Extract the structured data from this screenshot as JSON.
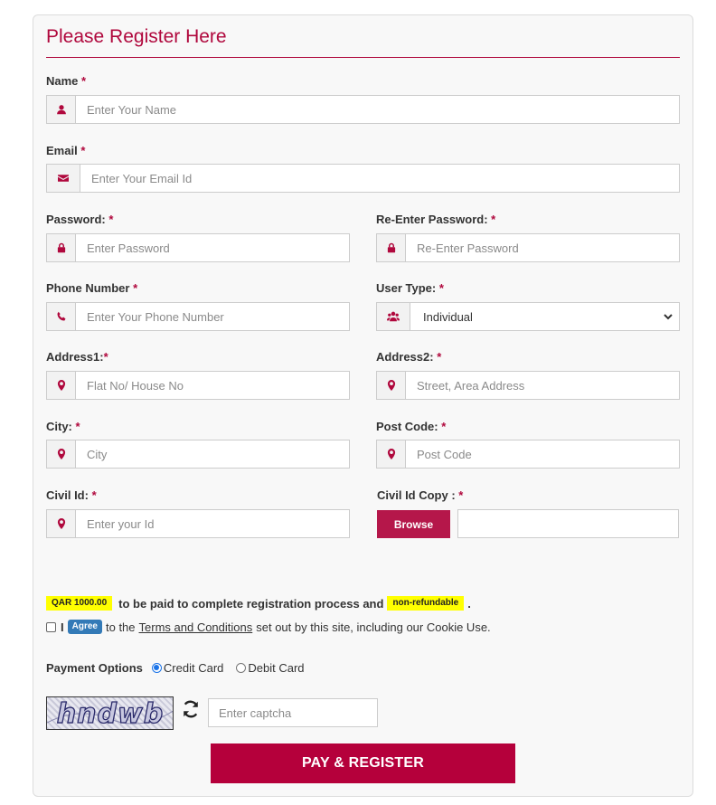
{
  "form": {
    "title": "Please Register Here"
  },
  "fields": {
    "name": {
      "label": "Name",
      "required": "*",
      "placeholder": "Enter Your Name",
      "icon": "user-icon"
    },
    "email": {
      "label": "Email",
      "required": "*",
      "placeholder": "Enter Your Email Id",
      "icon": "envelope-icon"
    },
    "password": {
      "label": "Password:",
      "required": "*",
      "placeholder": "Enter Password",
      "icon": "lock-icon"
    },
    "repassword": {
      "label": "Re-Enter Password:",
      "required": "*",
      "placeholder": "Re-Enter Password",
      "icon": "lock-icon"
    },
    "phone": {
      "label": "Phone Number",
      "required": "*",
      "placeholder": "Enter Your Phone Number",
      "icon": "phone-icon"
    },
    "usertype": {
      "label": "User Type:",
      "required": "*",
      "selected": "Individual",
      "icon": "users-icon"
    },
    "address1": {
      "label": "Address1:",
      "required": "*",
      "placeholder": "Flat No/ House No",
      "icon": "map-marker-icon"
    },
    "address2": {
      "label": "Address2:",
      "required": "*",
      "placeholder": "Street, Area Address",
      "icon": "map-marker-icon"
    },
    "city": {
      "label": "City:",
      "required": "*",
      "placeholder": "City",
      "icon": "map-marker-icon"
    },
    "postcode": {
      "label": "Post Code:",
      "required": "*",
      "placeholder": "Post Code",
      "icon": "map-marker-icon"
    },
    "civilid": {
      "label": "Civil Id:",
      "required": "*",
      "placeholder": "Enter your Id",
      "icon": "map-marker-icon"
    },
    "civilidcopy": {
      "label": "Civil Id Copy :",
      "required": "*",
      "browse_label": "Browse"
    }
  },
  "fee": {
    "amount": "QAR 1000.00",
    "text": "to be paid to complete registration process and",
    "badge": "non-refundable",
    "end": "."
  },
  "terms": {
    "prefix": "I",
    "agree_badge": "Agree",
    "to_the": "to the",
    "link": "Terms and Conditions",
    "suffix": "set out by this site, including our Cookie Use.",
    "checked": false
  },
  "payment": {
    "label": "Payment Options",
    "options": [
      {
        "label": "Credit Card",
        "selected": true
      },
      {
        "label": "Debit Card",
        "selected": false
      }
    ]
  },
  "captcha": {
    "image_text": "hndwb",
    "placeholder": "Enter captcha",
    "refresh_icon": "refresh-icon"
  },
  "submit": {
    "label": "PAY & REGISTER"
  },
  "colors": {
    "accent": "#b0083d",
    "button": "#b5003b",
    "highlight": "#ffff00",
    "agree": "#337ab7"
  }
}
